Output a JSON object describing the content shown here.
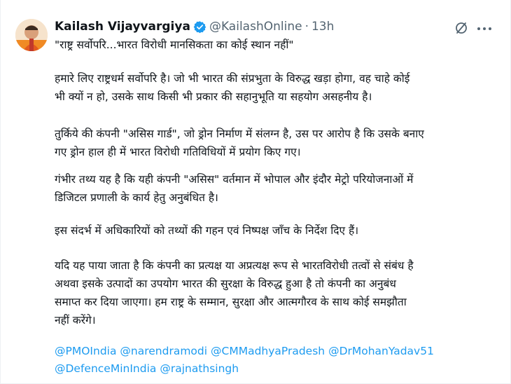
{
  "author": {
    "name": "Kailash Vijayvargiya",
    "handle": "@KailashOnline",
    "separator": "·",
    "time": "13h",
    "verified": true
  },
  "colors": {
    "mention": "#1d9bf0",
    "secondary_text": "#536471",
    "verified_badge": "#1d9bf0"
  },
  "icons": [
    "verified-badge-icon",
    "grok-icon",
    "more-options-icon"
  ],
  "tweet": {
    "headline": "\"राष्ट्र सर्वोपरि...भारत विरोधी मानसिकता का कोई स्थान नहीं\"",
    "p1_l1": "हमारे लिए राष्ट्रधर्म सर्वोपरि है। जो भी भारत की संप्रभुता के विरुद्ध खड़ा होगा, वह चाहे कोई",
    "p1_l2": "भी क्यों न हो, उसके साथ किसी भी प्रकार की सहानुभूति या सहयोग असहनीय है।",
    "p2_l1": "तुर्किये की कंपनी \"असिस गार्ड\", जो ड्रोन निर्माण में संलग्न है, उस पर आरोप है कि उसके बनाए",
    "p2_l2": "गए ड्रोन हाल ही में भारत विरोधी गतिविधियों में प्रयोग किए गए।",
    "p3_l1": "गंभीर तथ्य यह है कि यही कंपनी \"असिस\" वर्तमान में भोपाल और इंदौर मेट्रो परियोजनाओं में",
    "p3_l2": "डिजिटल प्रणाली के कार्य हेतु अनुबंधित है।",
    "p4_l1": "इस संदर्भ में अधिकारियों को तथ्यों की गहन एवं निष्पक्ष जाँच के निर्देश दिए हैं।",
    "p5_l1": "यदि यह पाया जाता है कि कंपनी का प्रत्यक्ष या अप्रत्यक्ष रूप से भारतविरोधी तत्वों से संबंध है",
    "p5_l2": "अथवा इसके उत्पादों का उपयोग भारत की सुरक्षा के विरुद्ध हुआ है तो कंपनी का अनुबंध",
    "p5_l3": "समाप्त कर दिया जाएगा। हम राष्ट्र के सम्मान, सुरक्षा और आत्मगौरव के साथ कोई समझौता",
    "p5_l4": "नहीं करेंगे।"
  },
  "mentions": [
    "@PMOIndia",
    "@narendramodi",
    "@CMMadhyaPradesh",
    "@DrMohanYadav51",
    "@DefenceMinIndia",
    "@rajnathsingh"
  ]
}
